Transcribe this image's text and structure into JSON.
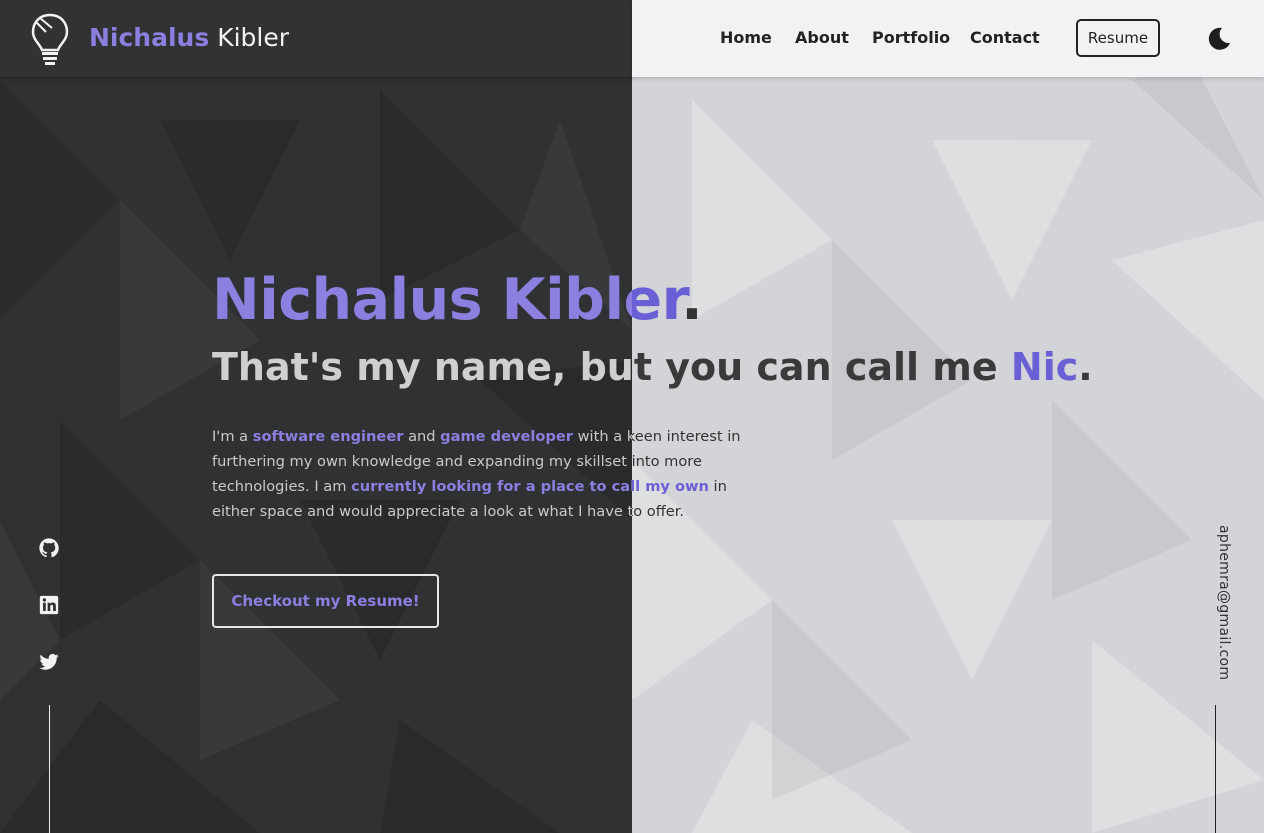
{
  "brand": {
    "first": "Nichalus",
    "last": "Kibler"
  },
  "nav": {
    "items": [
      {
        "label": "Home"
      },
      {
        "label": "About"
      },
      {
        "label": "Portfolio"
      },
      {
        "label": "Contact"
      }
    ],
    "resume_label": "Resume"
  },
  "hero": {
    "name": "Nichalus Kibler",
    "name_punct": ".",
    "subtitle_prefix": "That's my name, but you can call me ",
    "subtitle_highlight": "Nic",
    "subtitle_suffix": ".",
    "bio_parts": {
      "p1": "I'm a ",
      "h1": "software engineer",
      "p2": " and ",
      "h2": "game developer",
      "p3": " with a keen interest in furthering my own knowledge and expanding my skillset into more technologies. I am ",
      "h3": "currently looking for a place to call my own",
      "p4": " in either space and would appreciate a look at what I have to offer."
    },
    "cta_label": "Checkout my Resume!"
  },
  "socials": [
    {
      "icon": "github-icon"
    },
    {
      "icon": "linkedin-icon"
    },
    {
      "icon": "twitter-icon"
    }
  ],
  "email": "aphemra@gmail.com",
  "colors": {
    "accent": "#8b7fe0",
    "accent_dark": "#6b5fd6",
    "dark_bg": "#2f3133",
    "light_bg": "#d3d4d7"
  }
}
